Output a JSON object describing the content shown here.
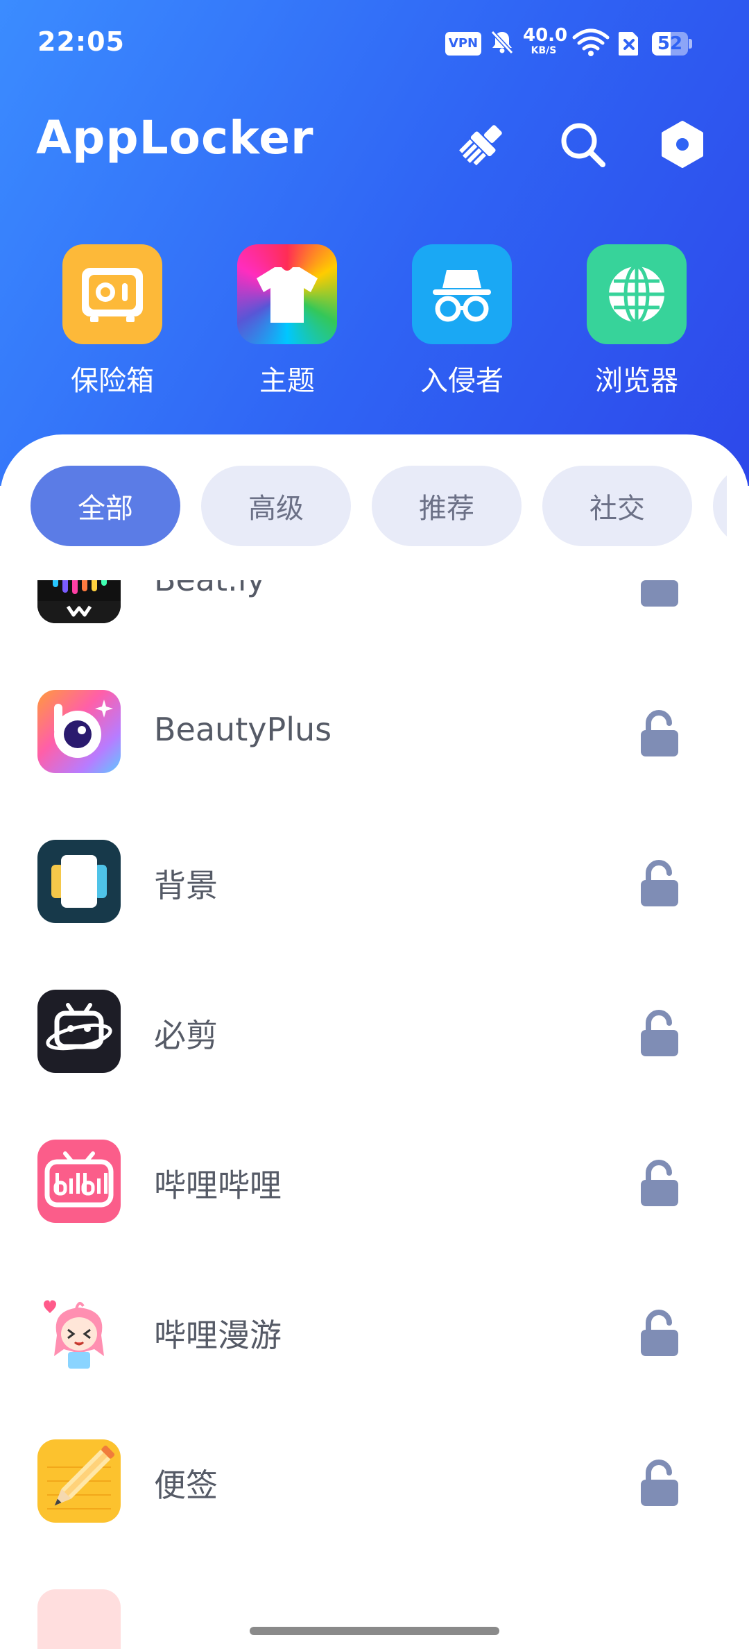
{
  "status_bar": {
    "time": "22:05",
    "vpn_label": "VPN",
    "net_speed_value": "40.0",
    "net_speed_unit": "KB/S",
    "battery_level": "52",
    "battery_fraction": 0.52
  },
  "header": {
    "title": "AppLocker",
    "actions": [
      {
        "icon": "clean-brush-icon"
      },
      {
        "icon": "search-icon"
      },
      {
        "icon": "settings-hexagon-icon"
      }
    ]
  },
  "shortcuts": [
    {
      "label": "保险箱",
      "icon": "safe-icon",
      "color": "#fdb939"
    },
    {
      "label": "主题",
      "icon": "tshirt-icon",
      "color": "rainbow"
    },
    {
      "label": "入侵者",
      "icon": "incognito-icon",
      "color": "#1aa8f4"
    },
    {
      "label": "浏览器",
      "icon": "globe-icon",
      "color": "#37d39a"
    }
  ],
  "filters": {
    "chips": [
      "全部",
      "高级",
      "推荐",
      "社交"
    ],
    "active": "全部"
  },
  "apps": [
    {
      "name": "Beat.ly",
      "icon": "beatly-icon",
      "locked": false
    },
    {
      "name": "BeautyPlus",
      "icon": "beautyplus-icon",
      "locked": false
    },
    {
      "name": "背景",
      "icon": "wallpaper-app-icon",
      "locked": false
    },
    {
      "name": "必剪",
      "icon": "bijian-icon",
      "locked": false
    },
    {
      "name": "哔哩哔哩",
      "icon": "bilibili-icon",
      "locked": false
    },
    {
      "name": "哔哩漫游",
      "icon": "bilibili-roaming-icon",
      "locked": false
    },
    {
      "name": "便签",
      "icon": "notes-icon",
      "locked": false
    }
  ],
  "colors": {
    "header_start": "#3b8cff",
    "header_end": "#2d48ea",
    "chip_active": "#5b7ce6",
    "chip_inactive": "#e8ebf8",
    "lock_icon": "#7f8db5"
  }
}
